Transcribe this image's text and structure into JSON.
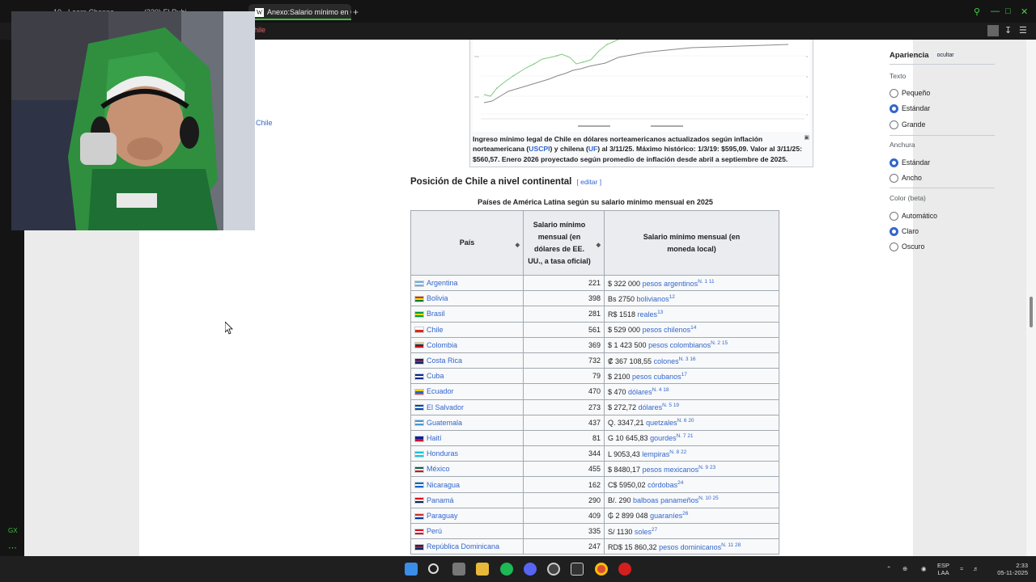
{
  "browser": {
    "tabs": [
      {
        "label": "10 · Learn Channe..."
      },
      {
        "label": "(330) El Rubi..."
      },
      {
        "label": "Anexo:Salario mínimo en Chile",
        "favicon": "W"
      }
    ],
    "new_tab": "+",
    "address": "hile",
    "accent": "#43d643"
  },
  "article": {
    "chart_caption_pre": "Ingreso mínimo legal de Chile en dólares norteamericanos actualizados según inflación norteamericana (",
    "chart_caption_l1": "USCPI",
    "chart_caption_mid": ") y chilena (",
    "chart_caption_l2": "UF",
    "chart_caption_post": ") al 3/11/25. Máximo histórico: 1/3/19: $595,09. Valor al 3/11/25: $560,57. Enero 2026 proyectado según promedio de inflación desde abril a septiembre de 2025.",
    "section_heading": "Posición de Chile a nivel continental",
    "edit_label": "[ editar ]",
    "table_caption": "Países de América Latina según su salario mínimo mensual en 2025",
    "col_country": "País",
    "col_usd": "Salario mínimo mensual (en dólares de EE. UU., a tasa oficial)",
    "col_local": "Salario mínimo mensual (en moneda local)",
    "rows": [
      {
        "country": "Argentina",
        "usd": "221",
        "amount": "$ 322 000",
        "currency": "pesos argentinos",
        "note": "N. 1 11",
        "flag": [
          "#74acdf",
          "#ffffff",
          "#74acdf"
        ]
      },
      {
        "country": "Bolivia",
        "usd": "398",
        "amount": "Bs 2750",
        "currency": "bolivianos",
        "note": "12",
        "flag": [
          "#d52b1e",
          "#f9e300",
          "#007934"
        ]
      },
      {
        "country": "Brasil",
        "usd": "281",
        "amount": "R$ 1518",
        "currency": "reales",
        "note": "13",
        "flag": [
          "#009c3b",
          "#ffdf00",
          "#009c3b"
        ]
      },
      {
        "country": "Chile",
        "usd": "561",
        "amount": "$ 529 000",
        "currency": "pesos chilenos",
        "note": "14",
        "flag": [
          "#ffffff",
          "#d52b1e"
        ]
      },
      {
        "country": "Colombia",
        "usd": "369",
        "amount": "$ 1 423 500",
        "currency": "pesos colombianos",
        "note": "N. 2 15",
        "flag": [
          "#fcd116",
          "#003893",
          "#ce1126"
        ]
      },
      {
        "country": "Costa Rica",
        "usd": "732",
        "amount": "₡ 367 108,55",
        "currency": "colones",
        "note": "N. 3 16",
        "flag": [
          "#002b7f",
          "#ce1126",
          "#002b7f"
        ]
      },
      {
        "country": "Cuba",
        "usd": "79",
        "amount": "$ 2100",
        "currency": "pesos cubanos",
        "note": "17",
        "flag": [
          "#002a8f",
          "#ffffff",
          "#002a8f"
        ]
      },
      {
        "country": "Ecuador",
        "usd": "470",
        "amount": "$ 470",
        "currency": "dólares",
        "note": "N. 4 18",
        "flag": [
          "#ffd100",
          "#0072ce",
          "#ef3340"
        ]
      },
      {
        "country": "El Salvador",
        "usd": "273",
        "amount": "$ 272,72",
        "currency": "dólares",
        "note": "N. 5 19",
        "flag": [
          "#0047ab",
          "#ffffff",
          "#0047ab"
        ]
      },
      {
        "country": "Guatemala",
        "usd": "437",
        "amount": "Q. 3347,21",
        "currency": "quetzales",
        "note": "N. 6 20",
        "flag": [
          "#4997d0",
          "#ffffff",
          "#4997d0"
        ]
      },
      {
        "country": "Haití",
        "usd": "81",
        "amount": "G 10 645,83",
        "currency": "gourdes",
        "note": "N. 7 21",
        "flag": [
          "#00209f",
          "#d21034"
        ]
      },
      {
        "country": "Honduras",
        "usd": "344",
        "amount": "L 9053,43",
        "currency": "lempiras",
        "note": "N. 8 22",
        "flag": [
          "#18c3df",
          "#ffffff",
          "#18c3df"
        ]
      },
      {
        "country": "México",
        "usd": "455",
        "amount": "$ 8480,17",
        "currency": "pesos mexicanos",
        "note": "N. 9 23",
        "flag": [
          "#006847",
          "#ffffff",
          "#ce1126"
        ]
      },
      {
        "country": "Nicaragua",
        "usd": "162",
        "amount": "C$ 5950,02",
        "currency": "córdobas",
        "note": "24",
        "flag": [
          "#0067c6",
          "#ffffff",
          "#0067c6"
        ]
      },
      {
        "country": "Panamá",
        "usd": "290",
        "amount": "B/. 290",
        "currency": "balboas panameños",
        "note": "N. 10 25",
        "flag": [
          "#da121a",
          "#ffffff",
          "#072357"
        ]
      },
      {
        "country": "Paraguay",
        "usd": "409",
        "amount": "₲ 2 899 048",
        "currency": "guaraníes",
        "note": "26",
        "flag": [
          "#d52b1e",
          "#ffffff",
          "#0038a8"
        ]
      },
      {
        "country": "Perú",
        "usd": "335",
        "amount": "S/ 1130",
        "currency": "soles",
        "note": "27",
        "flag": [
          "#d91023",
          "#ffffff",
          "#d91023"
        ]
      },
      {
        "country": "República Dominicana",
        "usd": "247",
        "amount": "RD$ 15 860,32",
        "currency": "pesos dominicanos",
        "note": "N. 11 28",
        "flag": [
          "#002d62",
          "#ce1126",
          "#002d62"
        ]
      }
    ],
    "side_link": "Chile"
  },
  "appearance": {
    "title": "Apariencia",
    "hide": "ocultar",
    "text_label": "Texto",
    "text_opts": [
      "Pequeño",
      "Estándar",
      "Grande"
    ],
    "width_label": "Anchura",
    "width_opts": [
      "Estándar",
      "Ancho"
    ],
    "color_label": "Color (beta)",
    "color_opts": [
      "Automático",
      "Claro",
      "Oscuro"
    ]
  },
  "sidebar": {
    "gx_label": "GX"
  },
  "tray": {
    "lang": "ESP",
    "layout": "LAA",
    "time": "2:33",
    "date": "05-11-2025"
  }
}
